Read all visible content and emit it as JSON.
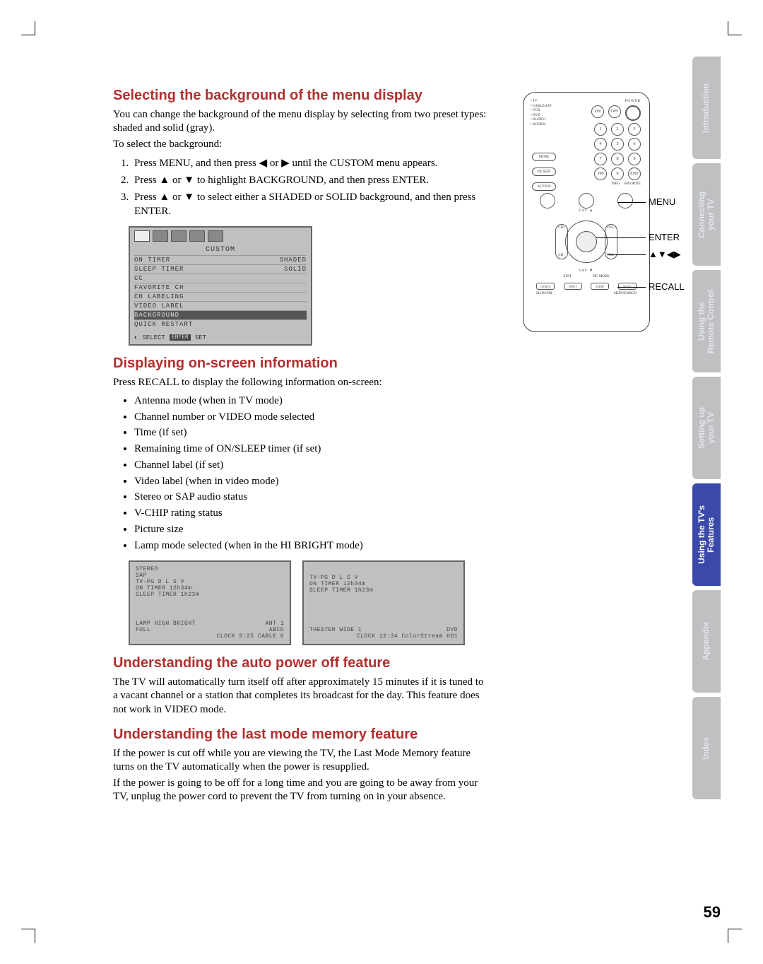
{
  "tabs": [
    {
      "label": "Introduction",
      "active": false
    },
    {
      "label": "Connecting\nyour TV",
      "active": false
    },
    {
      "label": "Using the\nRemote Control",
      "active": false
    },
    {
      "label": "Setting up\nyour TV",
      "active": false
    },
    {
      "label": "Using the TV's\nFeatures",
      "active": true
    },
    {
      "label": "Appendix",
      "active": false
    },
    {
      "label": "Index",
      "active": false
    }
  ],
  "section1": {
    "title": "Selecting the background of the menu display",
    "p1": "You can change the background of the menu display by selecting from two preset types: shaded and solid (gray).",
    "p2": "To select the background:",
    "steps": [
      "Press MENU, and then press ◀ or ▶ until the CUSTOM menu appears.",
      "Press ▲ or ▼ to highlight BACKGROUND, and then press ENTER.",
      "Press ▲ or ▼ to select either a SHADED or SOLID background, and then press ENTER."
    ]
  },
  "osd": {
    "title": "CUSTOM",
    "rows": [
      {
        "l": "ON TIMER",
        "r": "SHADED",
        "hl": false
      },
      {
        "l": "SLEEP TIMER",
        "r": "SOLID",
        "hl": false
      },
      {
        "l": "CC",
        "r": "",
        "hl": false
      },
      {
        "l": "FAVORITE CH",
        "r": "",
        "hl": false
      },
      {
        "l": "CH LABELING",
        "r": "",
        "hl": false
      },
      {
        "l": "VIDEO LABEL",
        "r": "",
        "hl": false
      },
      {
        "l": "BACKGROUND",
        "r": "",
        "hl": true
      },
      {
        "l": "QUICK RESTART",
        "r": "",
        "hl": false
      }
    ],
    "foot_select": "SELECT",
    "foot_enter": "ENTER",
    "foot_set": "SET"
  },
  "section2": {
    "title": "Displaying on-screen information",
    "p1": "Press RECALL to display the following information on-screen:",
    "bullets": [
      "Antenna mode (when in TV mode)",
      "Channel number or VIDEO mode selected",
      "Time (if set)",
      "Remaining time of ON/SLEEP timer (if set)",
      "Channel label (if set)",
      "Video label (when in video mode)",
      "Stereo or SAP audio status",
      "V-CHIP rating status",
      "Picture size",
      "Lamp mode selected (when in the HI BRIGHT mode)"
    ]
  },
  "info_panels": {
    "left": {
      "l1": "STEREO",
      "l2": "SAP",
      "l3": "TV-PG D L S V",
      "l4": "ON TIMER    12h34m",
      "l5": "SLEEP TIMER 1h23m",
      "b1l": "LAMP HIGH BRIGHT",
      "b1r": "ANT   1",
      "b2l": "FULL",
      "b2r": "ABCD",
      "b3": "CLOCK  9:25  CABLE   6"
    },
    "right": {
      "l1": "TV-PG D L S V",
      "l2": "ON TIMER    12h34m",
      "l3": "SLEEP TIMER 1h23m",
      "b1l": "THEATER WIDE 1",
      "b1r": "DVD",
      "b2": "CLOCK 12:34   ColorStream HD1"
    }
  },
  "section3": {
    "title": "Understanding the auto power off feature",
    "p1": "The TV will automatically turn itself off after approximately 15 minutes if it is tuned to a vacant channel or a station that completes its broadcast for the day. This feature does not work in VIDEO mode."
  },
  "section4": {
    "title": "Understanding the last mode memory feature",
    "p1": "If the power is cut off while you are viewing the TV, the Last Mode Memory feature turns on the TV automatically when the power is resupplied.",
    "p2": "If the power is going to be off for a long time and you are going to be away from your TV, unplug the power cord to prevent the TV from turning on in your absence."
  },
  "remote": {
    "power": "POWER",
    "devlist": "• TV\n• CABLE/SAT\n• VCR\n• DVD\n• AUDIO1\n• AUDIO2",
    "mode_pill": "MODE",
    "picsize_pill": "PICSIZE",
    "action_pill": "ACTION",
    "info_sm": "INFO",
    "favorite_sm": "FAVORITE",
    "chrtn_sm": "CH RTN",
    "enter_center": "ENTER",
    "fav_top": "FAV ▲",
    "fav_bot": "FAV ▼",
    "ch_plus": "CH+",
    "ch_minus": "CH−",
    "vol_plus": "VOL+",
    "vol_minus": "VOL−",
    "exit": "EXIT",
    "picmode": "PIC MODE",
    "foot": [
      "CH RTN",
      "INPUT",
      "SLEEP",
      "MUTE"
    ],
    "foot2": [
      "SLOW/DR",
      "",
      "SKIP/SEARCH"
    ]
  },
  "callouts": {
    "menu": "MENU",
    "enter": "ENTER",
    "arrows": "▲▼◀▶",
    "recall": "RECALL"
  },
  "page_num": "59"
}
